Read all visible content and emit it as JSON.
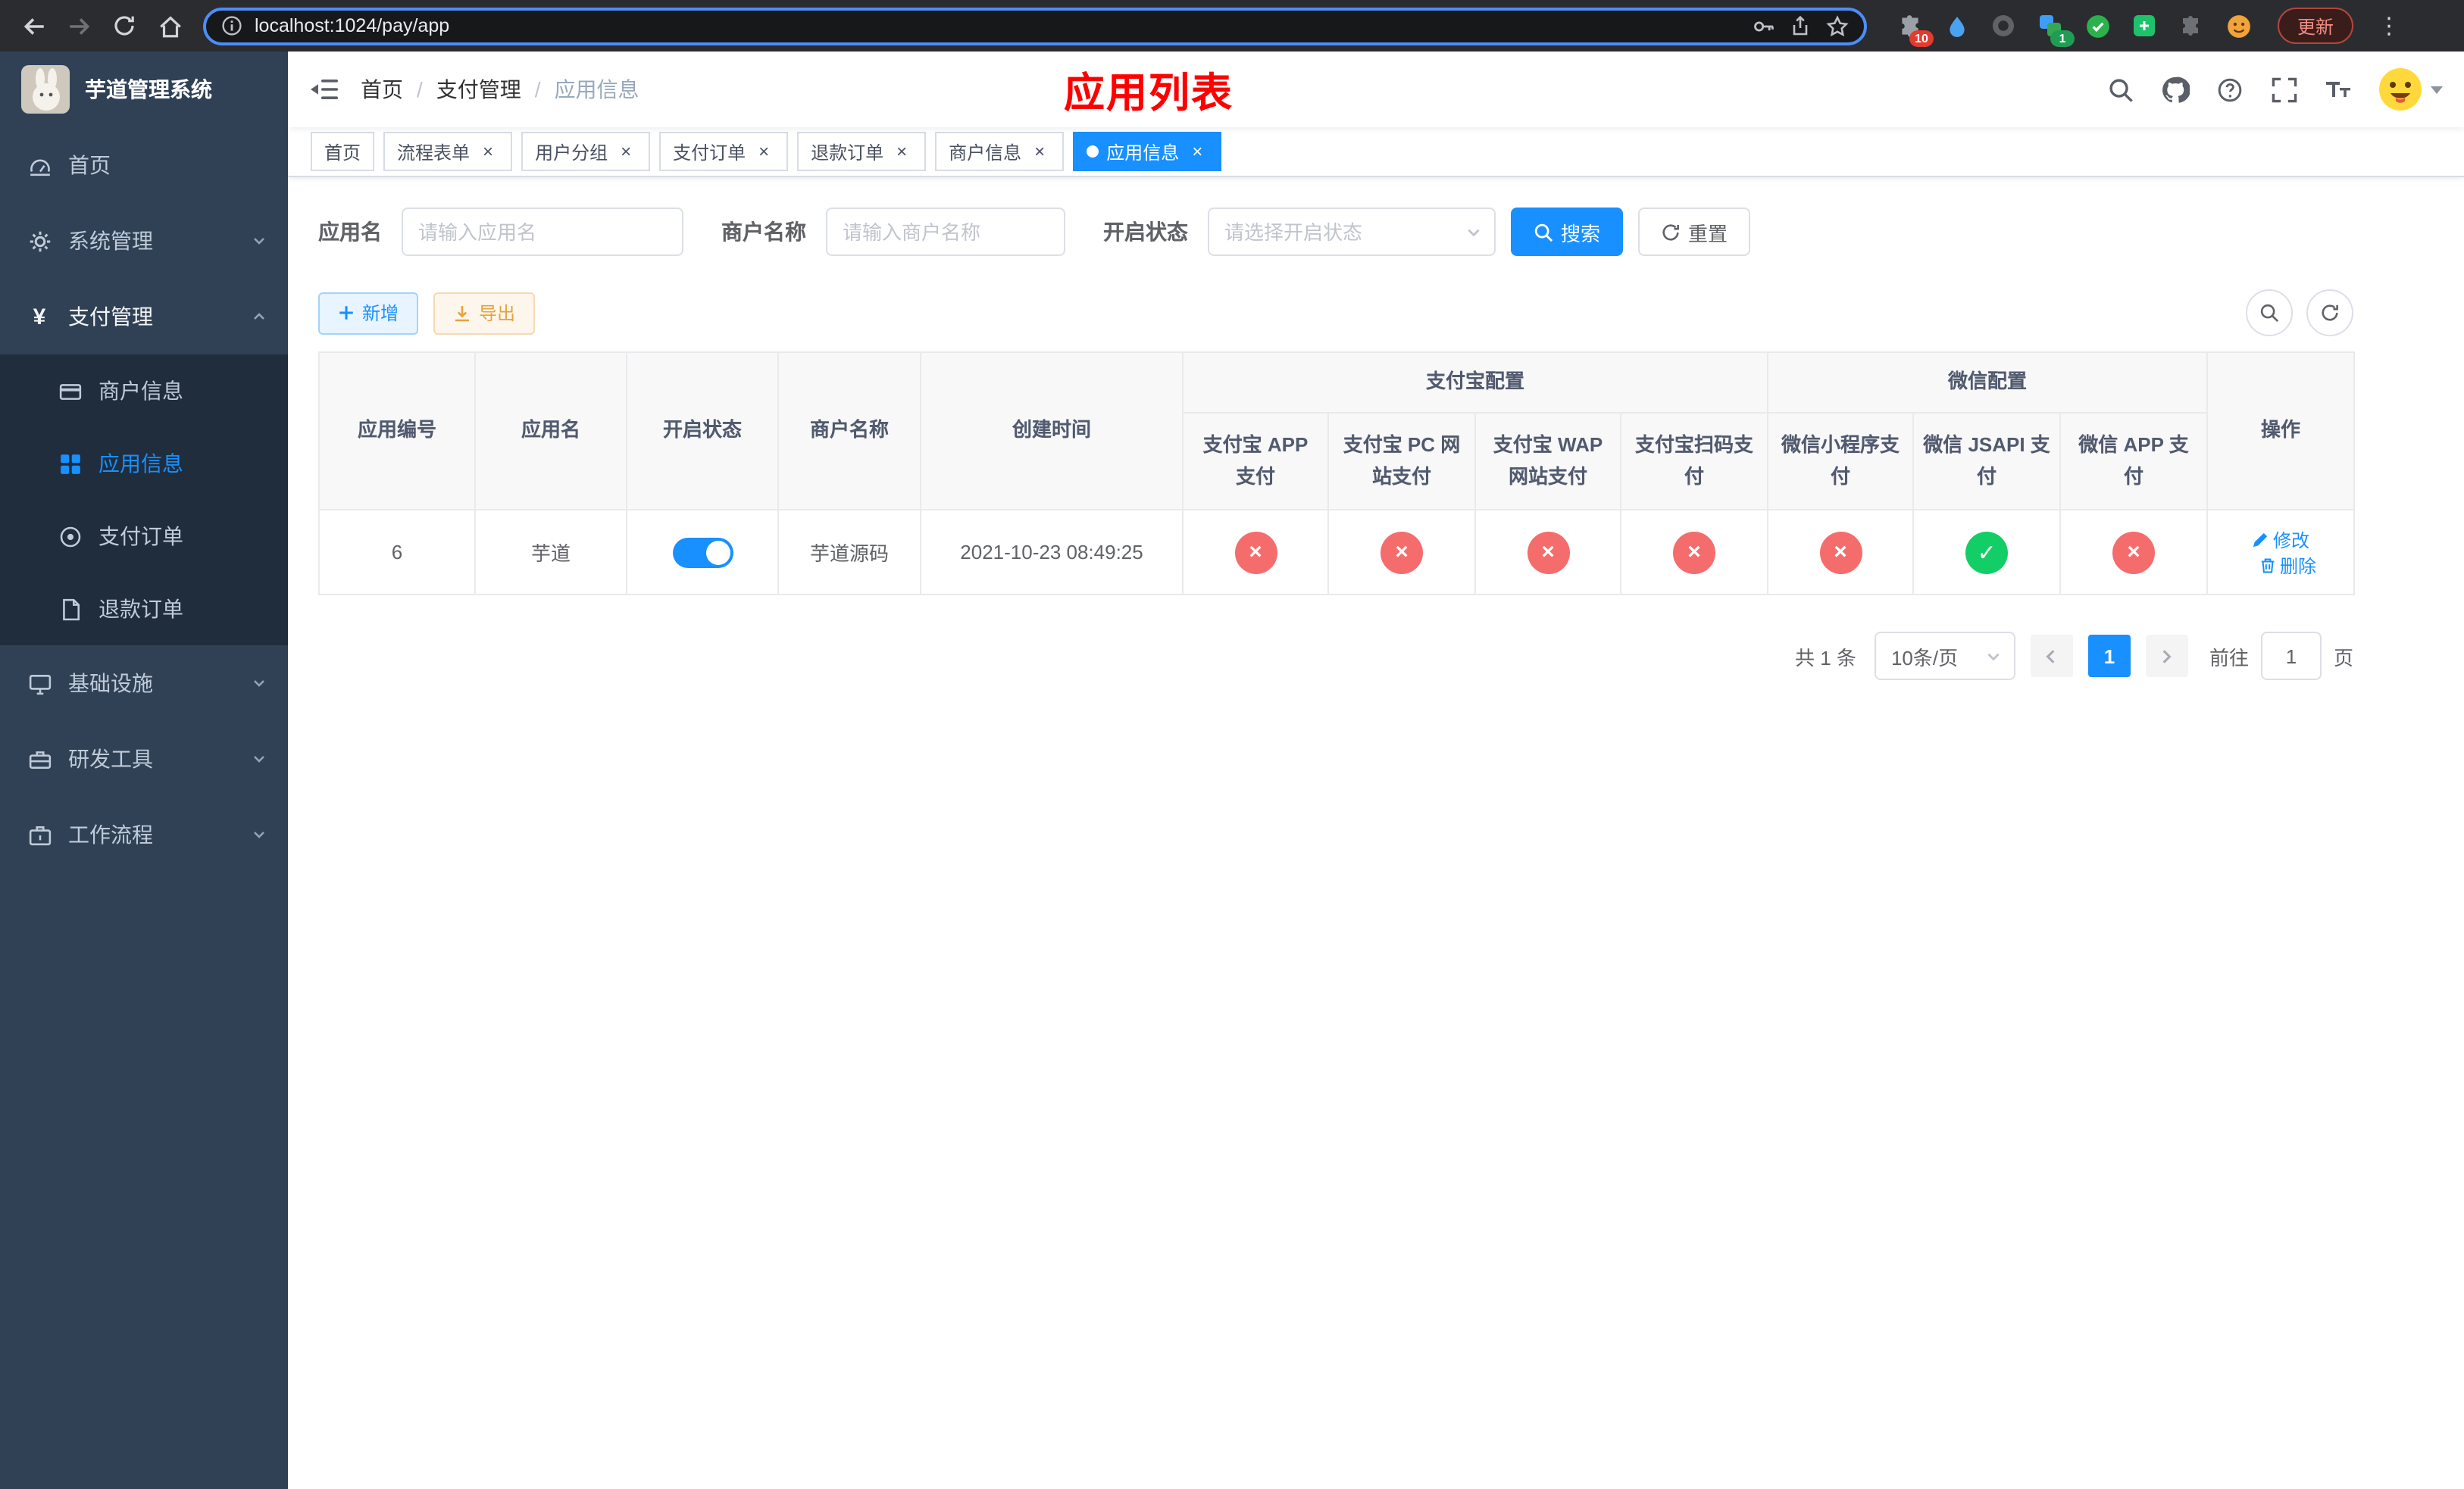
{
  "browser": {
    "url": "localhost:1024/pay/app",
    "update_label": "更新",
    "extension_badges": {
      "puzzle": "10",
      "translator": "1"
    }
  },
  "sidebar": {
    "app_title": "芋道管理系统",
    "items": [
      {
        "label": "首页"
      },
      {
        "label": "系统管理"
      },
      {
        "label": "支付管理"
      },
      {
        "label": "基础设施"
      },
      {
        "label": "研发工具"
      },
      {
        "label": "工作流程"
      }
    ],
    "payment_children": [
      {
        "label": "商户信息"
      },
      {
        "label": "应用信息"
      },
      {
        "label": "支付订单"
      },
      {
        "label": "退款订单"
      }
    ]
  },
  "navbar": {
    "breadcrumb": [
      "首页",
      "支付管理",
      "应用信息"
    ],
    "page_title": "应用列表"
  },
  "tabs": [
    {
      "label": "首页"
    },
    {
      "label": "流程表单"
    },
    {
      "label": "用户分组"
    },
    {
      "label": "支付订单"
    },
    {
      "label": "退款订单"
    },
    {
      "label": "商户信息"
    },
    {
      "label": "应用信息"
    }
  ],
  "filters": {
    "app_name_label": "应用名",
    "app_name_placeholder": "请输入应用名",
    "merchant_label": "商户名称",
    "merchant_placeholder": "请输入商户名称",
    "status_label": "开启状态",
    "status_placeholder": "请选择开启状态",
    "search_label": "搜索",
    "reset_label": "重置"
  },
  "toolbar": {
    "add_label": "新增",
    "export_label": "导出"
  },
  "table": {
    "group_alipay": "支付宝配置",
    "group_wechat": "微信配置",
    "col_app_id": "应用编号",
    "col_app_name": "应用名",
    "col_status": "开启状态",
    "col_merchant": "商户名称",
    "col_created": "创建时间",
    "col_alipay_app": "支付宝 APP 支付",
    "col_alipay_pc": "支付宝 PC 网站支付",
    "col_alipay_wap": "支付宝 WAP 网站支付",
    "col_alipay_qr": "支付宝扫码支付",
    "col_wx_mini": "微信小程序支付",
    "col_wx_jsapi": "微信 JSAPI 支付",
    "col_wx_app": "微信 APP 支付",
    "col_actions": "操作",
    "rows": [
      {
        "app_id": "6",
        "app_name": "芋道",
        "status_on": true,
        "merchant": "芋道源码",
        "created": "2021-10-23 08:49:25",
        "configs": {
          "alipay_app": "disabled",
          "alipay_pc": "disabled",
          "alipay_wap": "disabled",
          "alipay_qr": "disabled",
          "wx_mini": "disabled",
          "wx_jsapi": "enabled",
          "wx_app": "disabled"
        },
        "edit_label": "修改",
        "delete_label": "删除"
      }
    ]
  },
  "pagination": {
    "total_label": "共 1 条",
    "page_size_label": "10条/页",
    "current_page": "1",
    "jump_prefix": "前往",
    "jump_value": "1",
    "jump_suffix": "页"
  },
  "colors": {
    "primary": "#1890ff",
    "danger": "#f56c6c",
    "success": "#13ce66",
    "title_red": "#ff0000",
    "sidebar_bg": "#304156",
    "submenu_bg": "#1f2d3d"
  }
}
